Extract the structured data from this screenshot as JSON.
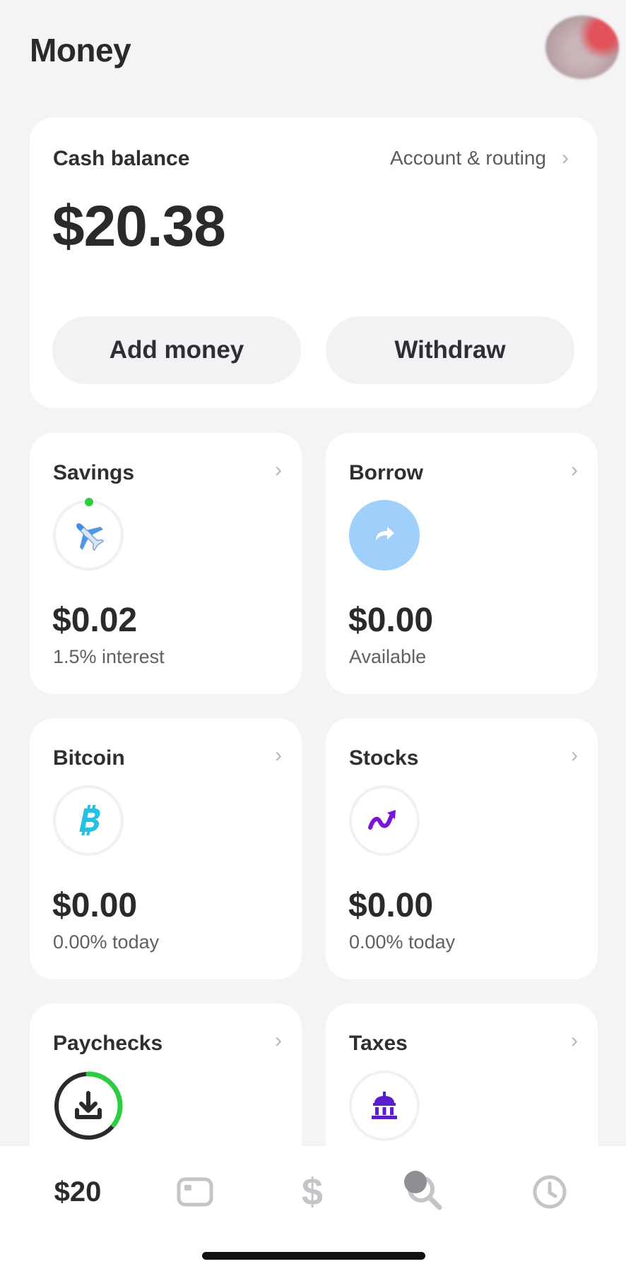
{
  "header": {
    "title": "Money"
  },
  "cash": {
    "label": "Cash balance",
    "account_link": "Account & routing",
    "amount": "$20.38",
    "add_money": "Add money",
    "withdraw": "Withdraw"
  },
  "tiles": [
    {
      "title": "Savings",
      "amount": "$0.02",
      "subtitle": "1.5% interest",
      "icon": "airplane-icon"
    },
    {
      "title": "Borrow",
      "amount": "$0.00",
      "subtitle": "Available",
      "icon": "arrow-forward-icon"
    },
    {
      "title": "Bitcoin",
      "amount": "$0.00",
      "subtitle": "0.00% today",
      "icon": "bitcoin-icon"
    },
    {
      "title": "Stocks",
      "amount": "$0.00",
      "subtitle": "0.00% today",
      "icon": "stocks-trend-icon"
    },
    {
      "title": "Paychecks",
      "icon": "download-icon"
    },
    {
      "title": "Taxes",
      "icon": "bank-building-icon"
    }
  ],
  "tabbar": {
    "balance_label": "$20",
    "pay_label": "$",
    "items": [
      "balance",
      "card-icon",
      "pay-icon",
      "search-icon",
      "clock-icon"
    ]
  },
  "colors": {
    "accent_green": "#2ecc40",
    "borrow_blue": "#9fd0fb",
    "bitcoin_cyan": "#25c1e0",
    "stocks_purple": "#7a15d8",
    "taxes_purple": "#5b1fc9"
  }
}
